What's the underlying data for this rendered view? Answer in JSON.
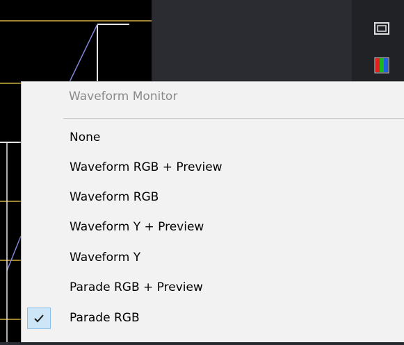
{
  "menu": {
    "header": "Waveform Monitor",
    "items": [
      {
        "label": "None",
        "checked": false
      },
      {
        "label": "Waveform RGB + Preview",
        "checked": false
      },
      {
        "label": "Waveform RGB",
        "checked": false
      },
      {
        "label": "Waveform Y + Preview",
        "checked": false
      },
      {
        "label": "Waveform Y",
        "checked": false
      },
      {
        "label": "Parade RGB + Preview",
        "checked": false
      },
      {
        "label": "Parade RGB",
        "checked": true
      }
    ],
    "check_icon": "checkmark-icon"
  },
  "toolbar": {
    "icons": [
      "single-view-icon",
      "rgb-parade-icon"
    ]
  },
  "colors": {
    "scope_background": "#000000",
    "scope_gold": "#a08530",
    "scope_white": "#e6e6e6",
    "scope_trace": "#7f86d6",
    "menu_background": "#f2f2f2",
    "check_highlight": "#cde6f7"
  }
}
